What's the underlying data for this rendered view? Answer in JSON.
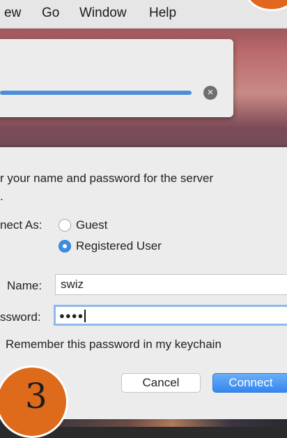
{
  "menubar": {
    "items": [
      "ew",
      "Go",
      "Window",
      "Help"
    ]
  },
  "progress": {
    "fraction": 0.93,
    "cancel_icon": "×"
  },
  "dialog": {
    "prompt": "r your name and password for the server",
    "prompt_cont": ".",
    "connect_as_label": "nect As:",
    "options": [
      "Guest",
      "Registered User"
    ],
    "selected_option": "Registered User",
    "name_label": "Name:",
    "name_value": "swiz",
    "password_label": "ssword:",
    "password_value": "●●●●",
    "remember_label": "Remember this password in my keychain",
    "cancel_label": "Cancel",
    "connect_label": "Connect"
  },
  "step": {
    "number": "3"
  },
  "colors": {
    "accent": "#3486f0",
    "badge": "#de6a1c"
  }
}
